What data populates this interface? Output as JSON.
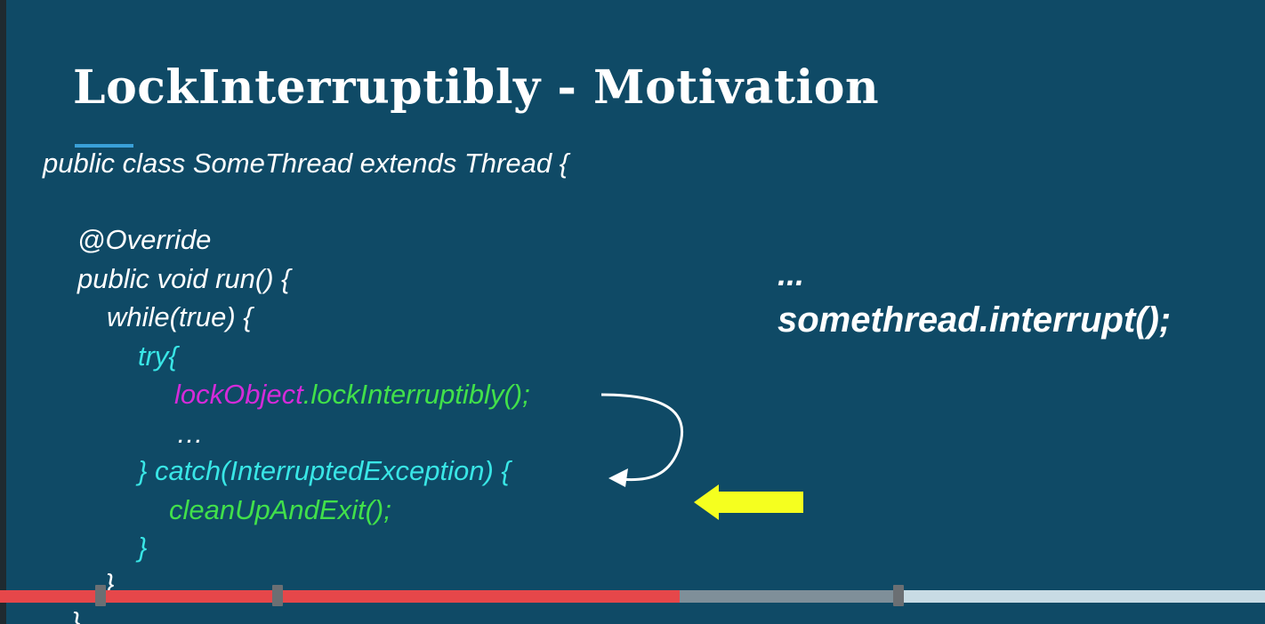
{
  "slide": {
    "title": "LockInterruptibly - Motivation"
  },
  "code": {
    "line_class": "public class SomeThread extends Thread {",
    "line_override": "@Override",
    "line_run": "public void run() {",
    "line_while": "while(true) {",
    "line_try": "try{",
    "line_lock_object": "lockObject",
    "line_lock_method": ".lockInterruptibly();",
    "line_ellipsis": "…",
    "line_catch": "} catch(InterruptedException) {",
    "line_cleanup": "cleanUpAndExit();",
    "line_close_try": "}",
    "line_close_while": "}",
    "line_close_run": "}"
  },
  "right": {
    "ellipsis": "...",
    "interrupt_call": "somethread.interrupt();"
  },
  "colors": {
    "background": "#0f4a66",
    "keyword_white": "#ffffff",
    "cyan": "#39e6e6",
    "green": "#41e04a",
    "magenta": "#d42bd9",
    "yellow_arrow": "#f5ff1f",
    "progress_played": "#e6474a"
  },
  "player": {
    "progress_fraction": 0.537,
    "buffered_fraction": 0.71
  }
}
